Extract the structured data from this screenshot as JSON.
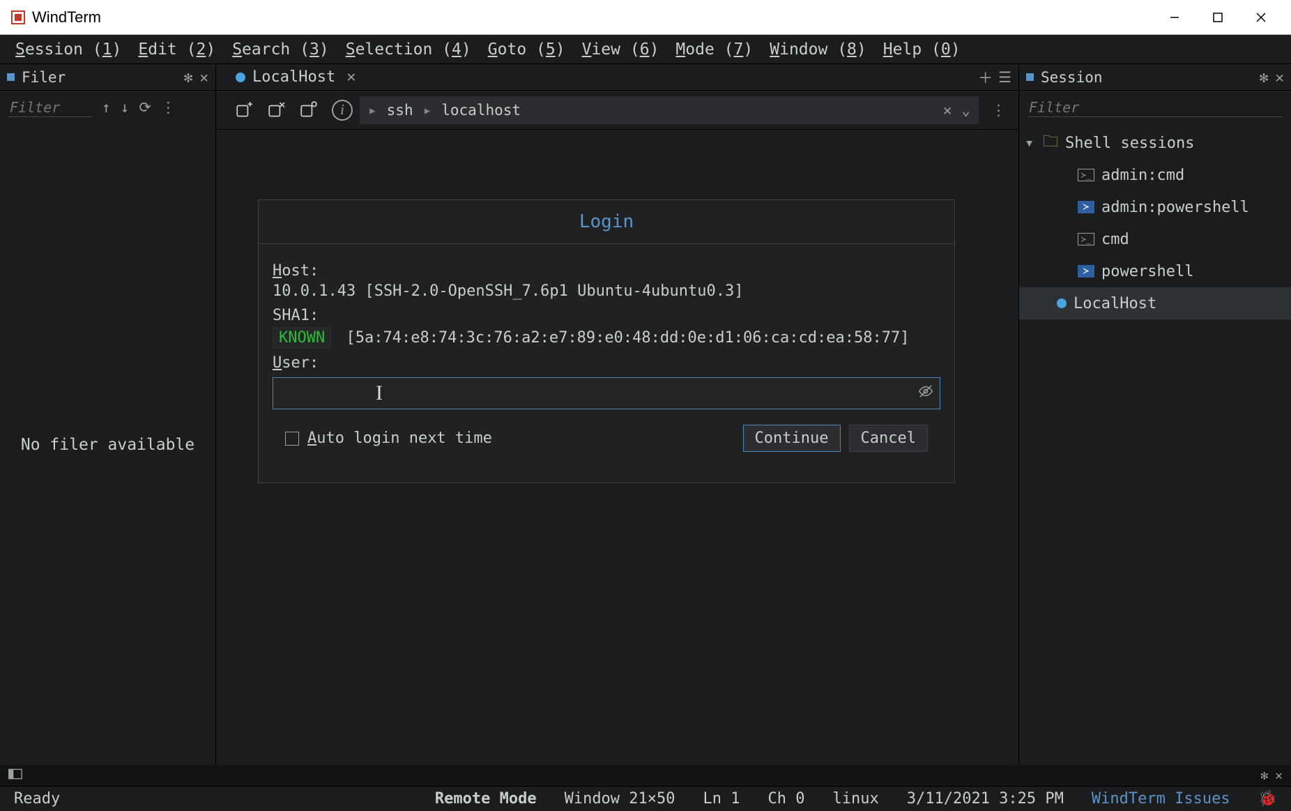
{
  "titlebar": {
    "app_name": "WindTerm"
  },
  "menubar": {
    "items": [
      {
        "label": "Session",
        "key": "S",
        "num": "1"
      },
      {
        "label": "Edit",
        "key": "E",
        "num": "2"
      },
      {
        "label": "Search",
        "key": "S",
        "num": "3"
      },
      {
        "label": "Selection",
        "key": "S",
        "num": "4"
      },
      {
        "label": "Goto",
        "key": "G",
        "num": "5"
      },
      {
        "label": "View",
        "key": "V",
        "num": "6"
      },
      {
        "label": "Mode",
        "key": "M",
        "num": "7"
      },
      {
        "label": "Window",
        "key": "W",
        "num": "8"
      },
      {
        "label": "Help",
        "key": "H",
        "num": "0"
      }
    ]
  },
  "filer": {
    "title": "Filer",
    "filter_placeholder": "Filter",
    "empty_text": "No filer available"
  },
  "editor": {
    "tab_label": "LocalHost",
    "breadcrumb": {
      "first": "ssh",
      "second": "localhost"
    }
  },
  "login": {
    "title": "Login",
    "host_label": "Host:",
    "host_line": "10.0.1.43 [SSH-2.0-OpenSSH_7.6p1 Ubuntu-4ubuntu0.3]",
    "sha1_label": "SHA1:",
    "known_badge": "KNOWN",
    "fingerprint": "[5a:74:e8:74:3c:76:a2:e7:89:e0:48:dd:0e:d1:06:ca:cd:ea:58:77]",
    "user_label": "User:",
    "user_value": "",
    "auto_login_label": "Auto login next time",
    "continue_label": "Continue",
    "cancel_label": "Cancel"
  },
  "session": {
    "title": "Session",
    "filter_placeholder": "Filter",
    "root": "Shell sessions",
    "items": [
      {
        "type": "cmd",
        "label": "admin:cmd"
      },
      {
        "type": "ps",
        "label": "admin:powershell"
      },
      {
        "type": "cmd",
        "label": "cmd"
      },
      {
        "type": "ps",
        "label": "powershell"
      }
    ],
    "selected": "LocalHost"
  },
  "status": {
    "ready": "Ready",
    "mode": "Remote Mode",
    "window": "Window 21×50",
    "ln": "Ln 1",
    "ch": "Ch 0",
    "os": "linux",
    "datetime": "3/11/2021 3:25 PM",
    "issues_link": "WindTerm Issues"
  }
}
